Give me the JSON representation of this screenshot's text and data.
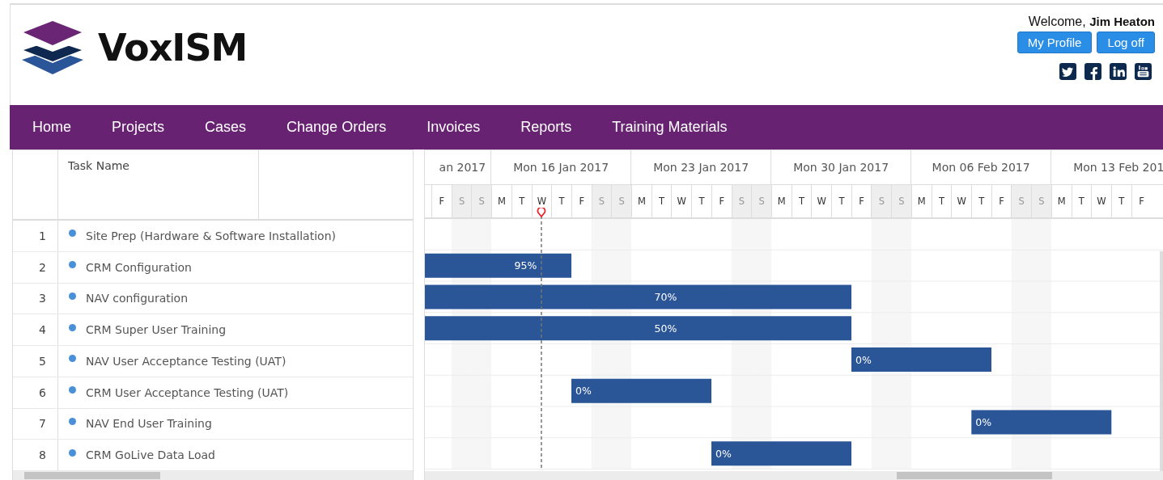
{
  "header": {
    "logo_text": "VoxISM",
    "welcome": "Welcome,",
    "user": "Jim Heaton",
    "buttons": [
      "My Profile",
      "Log off"
    ],
    "social": [
      {
        "kind": "twitter"
      },
      {
        "kind": "facebook"
      },
      {
        "kind": "linkedin"
      },
      {
        "kind": "youtube"
      }
    ]
  },
  "nav": {
    "items": [
      "Home",
      "Projects",
      "Cases",
      "Change Orders",
      "Invoices",
      "Reports",
      "Training Materials"
    ]
  },
  "grid": {
    "task_name_header": "Task Name"
  },
  "tasks": [
    {
      "number": "1",
      "name": "Site Prep (Hardware & Software Installation)"
    },
    {
      "number": "2",
      "name": "CRM Configuration",
      "bar_label": "95%"
    },
    {
      "number": "3",
      "name": "NAV configuration",
      "bar_label": "70%"
    },
    {
      "number": "4",
      "name": "CRM Super User Training",
      "bar_label": "50%"
    },
    {
      "number": "5",
      "name": "NAV User Acceptance Testing (UAT)",
      "bar_label": "0%"
    },
    {
      "number": "6",
      "name": "CRM User Acceptance Testing (UAT)",
      "bar_label": "0%"
    },
    {
      "number": "7",
      "name": "NAV End User Training",
      "bar_label": "0%"
    },
    {
      "number": "8",
      "name": "CRM GoLive Data Load",
      "bar_label": "0%"
    }
  ],
  "timeline": {
    "weeks": [
      "an 2017",
      "Mon 16 Jan 2017",
      "Mon 23 Jan 2017",
      "Mon 30 Jan 2017",
      "Mon 06 Feb 2017",
      "Mon 13 Feb 201"
    ],
    "days": [
      {
        "label": "F",
        "weekend": false
      },
      {
        "label": "S",
        "weekend": true
      },
      {
        "label": "S",
        "weekend": true
      },
      {
        "label": "M",
        "weekend": false
      },
      {
        "label": "T",
        "weekend": false
      },
      {
        "label": "W",
        "weekend": false
      },
      {
        "label": "T",
        "weekend": false
      },
      {
        "label": "F",
        "weekend": false
      },
      {
        "label": "S",
        "weekend": true
      },
      {
        "label": "S",
        "weekend": true
      },
      {
        "label": "M",
        "weekend": false
      },
      {
        "label": "T",
        "weekend": false
      },
      {
        "label": "W",
        "weekend": false
      },
      {
        "label": "T",
        "weekend": false
      },
      {
        "label": "F",
        "weekend": false
      },
      {
        "label": "S",
        "weekend": true
      },
      {
        "label": "S",
        "weekend": true
      },
      {
        "label": "M",
        "weekend": false
      },
      {
        "label": "T",
        "weekend": false
      },
      {
        "label": "W",
        "weekend": false
      },
      {
        "label": "T",
        "weekend": false
      },
      {
        "label": "F",
        "weekend": false
      },
      {
        "label": "S",
        "weekend": true
      },
      {
        "label": "S",
        "weekend": true
      },
      {
        "label": "M",
        "weekend": false
      },
      {
        "label": "T",
        "weekend": false
      },
      {
        "label": "W",
        "weekend": false
      },
      {
        "label": "T",
        "weekend": false
      },
      {
        "label": "F",
        "weekend": false
      },
      {
        "label": "S",
        "weekend": true
      },
      {
        "label": "S",
        "weekend": true
      },
      {
        "label": "M",
        "weekend": false
      },
      {
        "label": "T",
        "weekend": false
      },
      {
        "label": "W",
        "weekend": false
      },
      {
        "label": "T",
        "weekend": false
      },
      {
        "label": "F",
        "weekend": false
      }
    ]
  }
}
